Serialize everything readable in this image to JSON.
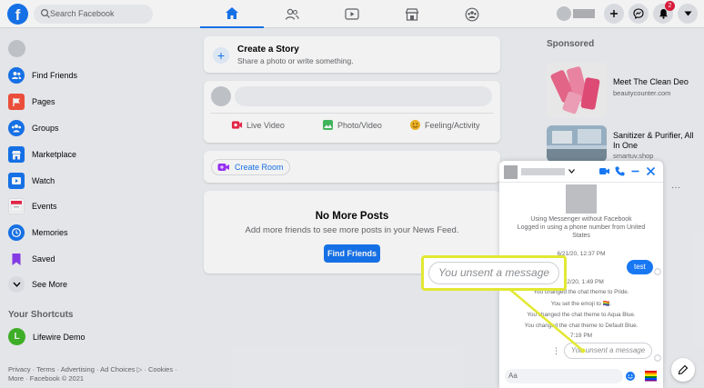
{
  "topbar": {
    "logo": "f",
    "search_placeholder": "Search Facebook",
    "notification_count": "2",
    "tabs": [
      {
        "icon": "home-icon",
        "active": true
      },
      {
        "icon": "friends-icon",
        "active": false
      },
      {
        "icon": "watch-icon",
        "active": false
      },
      {
        "icon": "marketplace-icon",
        "active": false
      },
      {
        "icon": "groups-icon",
        "active": false
      }
    ]
  },
  "sidebar": {
    "items": [
      {
        "label": "Find Friends",
        "icon": "friends-icon",
        "color": "#1877f2"
      },
      {
        "label": "Pages",
        "icon": "flag-icon",
        "color": "#f7533e"
      },
      {
        "label": "Groups",
        "icon": "groups-icon",
        "color": "#1877f2"
      },
      {
        "label": "Marketplace",
        "icon": "marketplace-icon",
        "color": "#1877f2"
      },
      {
        "label": "Watch",
        "icon": "watch-icon",
        "color": "#1877f2"
      },
      {
        "label": "Events",
        "icon": "calendar-icon",
        "color": "#f02849"
      },
      {
        "label": "Memories",
        "icon": "clock-icon",
        "color": "#1877f2"
      },
      {
        "label": "Saved",
        "icon": "bookmark-icon",
        "color": "#8c3ff0"
      },
      {
        "label": "See More",
        "icon": "chevron-down-icon",
        "color": "#e4e6eb"
      }
    ],
    "shortcuts_title": "Your Shortcuts",
    "shortcut": {
      "label": "Lifewire Demo",
      "initial": "L"
    },
    "footer": "Privacy · Terms · Advertising · Ad Choices ▷ · Cookies · More · Facebook © 2021"
  },
  "feed": {
    "story_title": "Create a Story",
    "story_sub": "Share a photo or write something.",
    "live_video": "Live Video",
    "photo_video": "Photo/Video",
    "feeling": "Feeling/Activity",
    "create_room": "Create Room",
    "no_more_title": "No More Posts",
    "no_more_sub": "Add more friends to see more posts in your News Feed.",
    "find_friends_btn": "Find Friends"
  },
  "sponsored": {
    "title": "Sponsored",
    "ads": [
      {
        "title": "Meet The Clean Deo",
        "domain": "beautycounter.com"
      },
      {
        "title": "Sanitizer & Purifier, All In One",
        "domain": "smartuv.shop"
      }
    ]
  },
  "chat": {
    "info_line1": "Using Messenger without Facebook",
    "info_line2": "Logged in using a phone number from United States",
    "ts1": "6/21/20, 12:37 PM",
    "bubble": "test",
    "ts2": "6/22/20, 1:49 PM",
    "sys1": "You changed the chat theme to Pride.",
    "sys2": "You set the emoji to 🏳️‍🌈.",
    "sys3": "You changed the chat theme to Aqua Blue.",
    "sys4": "You changed the chat theme to Default Blue.",
    "ts3": "7:19 PM",
    "unsent": "You unsent a message",
    "input_placeholder": "Aa"
  },
  "callout": {
    "text": "You unsent a message",
    "color": "#e2e832"
  }
}
